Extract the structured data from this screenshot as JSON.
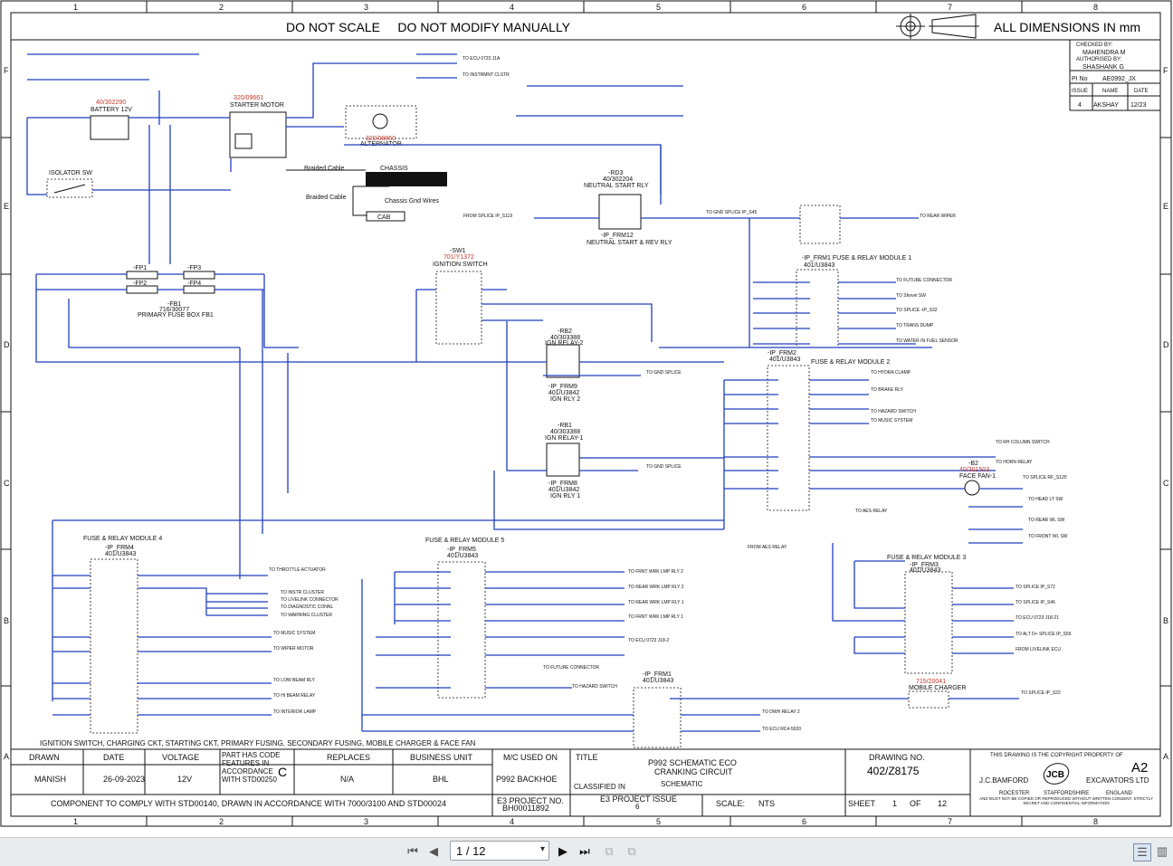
{
  "header": {
    "left": "DO NOT SCALE     DO NOT MODIFY MANUALLY",
    "right": "ALL DIMENSIONS IN mm",
    "size": "A2"
  },
  "grid": {
    "cols": [
      "1",
      "2",
      "3",
      "4",
      "5",
      "6",
      "7",
      "8"
    ],
    "rows": [
      "F",
      "E",
      "D",
      "C",
      "B",
      "A"
    ]
  },
  "revision": {
    "checked_by_lbl": "CHECKED BY:",
    "checked_by": "MAHENDRA M",
    "authorised_by_lbl": "AUTHORISED BY:",
    "authorised_by": "SHASHANK G",
    "pi_no_lbl": "PI No",
    "pi_no": "AE0992_JX",
    "issue_lbl": "ISSUE",
    "name_lbl": "NAME",
    "date_lbl": "DATE",
    "issue": "4",
    "name": "AKSHAY",
    "date": "12/23"
  },
  "title_block": {
    "drawn_lbl": "DRAWN",
    "date_lbl": "DATE",
    "voltage_lbl": "VOLTAGE",
    "part_code_lbl": "PART HAS CODE FEATURES IN ACCORDANCE WITH STD00250",
    "part_code": "C",
    "replaces_lbl": "REPLACES",
    "bu_lbl": "BUSINESS UNIT",
    "mc_lbl": "M/C USED ON",
    "title_lbl": "TITLE",
    "drawn": "MANISH",
    "date": "26-09-2023",
    "voltage": "12V",
    "replaces": "N/A",
    "bu": "BHL",
    "mc": "P992 BACKHOE",
    "title1": "P992 SCHEMATIC ECO",
    "title2": "CRANKING CIRCUIT",
    "classified_lbl": "CLASSIFIED IN",
    "classified": "SCHEMATIC",
    "drawing_no_lbl": "DRAWING NO.",
    "drawing_no": "402/Z8175",
    "comply": "COMPONENT TO COMPLY WITH STD00140, DRAWN IN ACCORDANCE WITH 7000/3100 AND STD00024",
    "e3_project_lbl": "E3 PROJECT NO.",
    "e3_project": "BH00011892",
    "e3_issue_lbl": "E3 PROJECT ISSUE",
    "e3_issue": "6",
    "scale_lbl": "SCALE:",
    "scale": "NTS",
    "sheet_lbl": "SHEET",
    "sheet": "1",
    "of_lbl": "OF",
    "sheets": "12",
    "copyright": "THIS DRAWING IS THE COPYRIGHT PROPERTY OF",
    "company": "J.C.BAMFORD",
    "company2": "EXCAVATORS LTD",
    "addr1": "ROCESTER",
    "addr2": "STAFFORDSHIRE",
    "addr3": "ENGLAND",
    "notice": "AND MUST NOT BE COPIED OR REPRODUCED WITHOUT WRITTEN CONSENT. STRICTLY SECRET AND CONFIDENTIAL INFORMATION",
    "logo": "JCB"
  },
  "caption": "IGNITION SWITCH, CHARGING CKT, STARTING CKT, PRIMARY FUSING, SECONDARY FUSING, MOBILE CHARGER & FACE FAN",
  "components": {
    "battery_code": "40/302290",
    "battery": "BATTERY 12V",
    "starter_code": "320/09661",
    "starter": "STARTER MOTOR",
    "alternator_code": "320/08860",
    "alternator": "ALTERNATOR",
    "isolator": "ISOLATOR SW",
    "chassis": "CHASSIS",
    "braided1": "Braided Cable",
    "braided2": "Braided Cable",
    "chassis_gnd": "Chassis Gnd Wires",
    "cab": "CAB",
    "rd3": "-RD3",
    "rd3_code": "40/302204",
    "rd3_name": "NEUTRAL START RLY",
    "ip_frm12": "-IP_FRM12",
    "neutral_rev": "NEUTRAL START & REV RLY",
    "sw1": "-SW1",
    "sw1_code": "701/Y1372",
    "ign_switch": "IGNITION SWITCH",
    "fb1": "-FB1",
    "fb1_code": "716/30077",
    "fb1_name": "PRIMARY FUSE BOX FB1",
    "fp1": "-FP1",
    "fp2": "-FP2",
    "fp3": "-FP3",
    "fp4": "-FP4",
    "rb2": "-RB2",
    "rb2_code": "40/303388",
    "rb2_name": "IGN RELAY-2",
    "frm9": "-IP_FRM9",
    "frm9_code": "401/U3842",
    "ign_rly2": "IGN RLY 2",
    "rb1": "-RB1",
    "rb1_code": "40/303388",
    "rb1_name": "IGN RELAY-1",
    "frm8": "-IP_FRM8",
    "frm8_code": "401/U3842",
    "ign_rly1": "IGN RLY 1",
    "frm1_mod": "-IP_FRM1 FUSE & RELAY MODULE 1",
    "frm1_code": "401/U3843",
    "frm2_mod": "FUSE & RELAY MODULE 2",
    "frm2": "-IP_FRM2",
    "frm2_code": "401/U3843",
    "frm3_mod": "FUSE & RELAY MODULE 3",
    "frm3": "-IP_FRM3",
    "frm3_code": "401/U3843",
    "frm4_mod": "FUSE & RELAY MODULE 4",
    "frm4": "-IP_FRM4",
    "frm4_code": "401/U3843",
    "frm5_mod": "FUSE & RELAY MODULE 5",
    "frm5": "-IP_FRM5",
    "frm5_code": "401/U3843",
    "frm1b": "-IP_FRM1",
    "frm1b_code": "401/U3843",
    "b2": "-B2",
    "b2_code": "40/301503",
    "face_fan": "FACE FAN-1",
    "mc_code": "715/20041",
    "mobile_charger": "MOBILE CHARGER"
  },
  "destinations": {
    "module1": [
      "TO FUTURE CONNECTOR",
      "TO Shovel SW",
      "TO SPLICE -IP_S32",
      "TO TRANS DUMP",
      "TO WATER IN FUEL SENSOR"
    ],
    "module2": [
      "TO HYDRA CLAMP",
      "TO BRAKE RLY",
      "TO HAZARD SWITCH",
      "TO MUSIC SYSTEM"
    ],
    "facefan": [
      "TO RH COLUMN SWITCH",
      "TO HORN RELAY",
      "TO SPLICE RF_S120",
      "TO HEAD LT SW",
      "TO REAR WL SW",
      "TO FRONT WL SW",
      "TO AES RELAY"
    ],
    "module3": [
      "TO SPLICE IP_S72",
      "TO SPLICE IP_S46",
      "TO ECU 0723 J18-21",
      "TO ALT D+ SPLICE IP_S55",
      "FROM LIVELINK ECU"
    ],
    "module4": [
      "TO THROTTLE ACTUATOR",
      "TO INSTR CLUSTER",
      "TO LIVELINK CONNECTOR",
      "TO DIAGNOSTIC CONNL",
      "TO WARNING CLUSTER",
      "TO MUSIC SYSTEM",
      "TO WIPER MOTOR",
      "TO LOW BEAM RLY",
      "TO HI BEAM RELAY",
      "TO INTERIOR LAMP"
    ],
    "module5": [
      "TO FRNT WRK LMP RLY 2",
      "TO REAR WRK LMP RLY 2",
      "TO REAR WRK LMP RLY 1",
      "TO FRNT WRK LMP RLY 1",
      "TO ECU 0723 J18-2",
      "TO FUTURE CONNECTOR",
      "TO HAZARD SWITCH"
    ],
    "frm1b": [
      "TO DWH RELAY 2",
      "TO ECU RC4-5020"
    ],
    "top": [
      "TO ECU 0723 J1A",
      "TO INSTRMNT CLSTR",
      "TO REAR WIPER",
      "TO GND SPLICE IP_S45",
      "FROM SPLICE IP_S119",
      "TO GND SPLICE",
      "TO GND SPLICE",
      "FROM AES RELAY",
      "TO SPLICE IP_S22"
    ]
  },
  "viewer": {
    "page_value": "1 / 12"
  },
  "colors": {
    "wire": "#1f3fbf",
    "code_red": "#c0392b",
    "ref_green": "#1a7a1a"
  }
}
